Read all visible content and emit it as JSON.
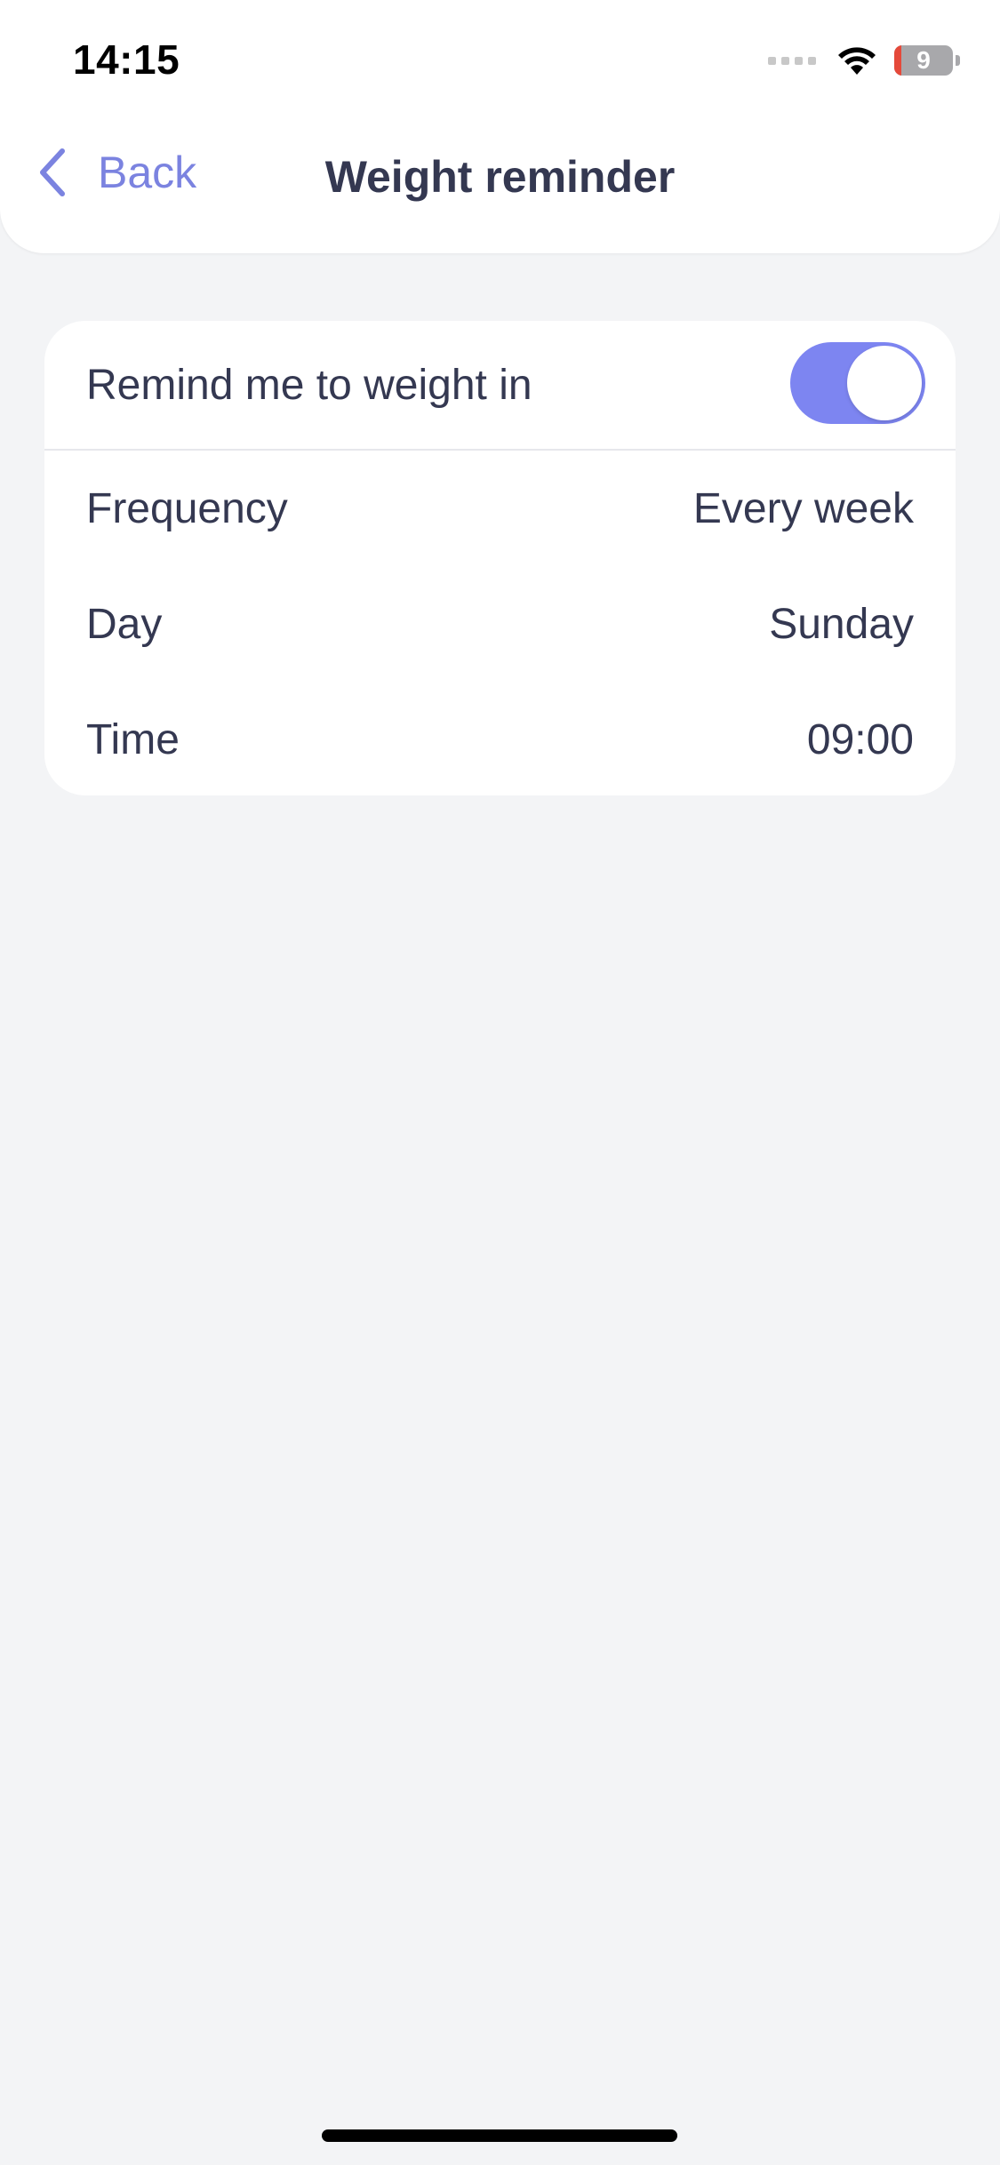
{
  "status_bar": {
    "time": "14:15",
    "battery_level": "9"
  },
  "header": {
    "back_label": "Back",
    "title": "Weight reminder"
  },
  "reminder": {
    "toggle_label": "Remind me to weight in",
    "toggle_on": true,
    "rows": [
      {
        "label": "Frequency",
        "value": "Every week"
      },
      {
        "label": "Day",
        "value": "Sunday"
      },
      {
        "label": "Time",
        "value": "09:00"
      }
    ]
  },
  "colors": {
    "accent": "#7b83e0",
    "toggle_on": "#7d85f1",
    "text": "#343851",
    "background": "#f3f4f6",
    "battery_low": "#e5493a"
  }
}
